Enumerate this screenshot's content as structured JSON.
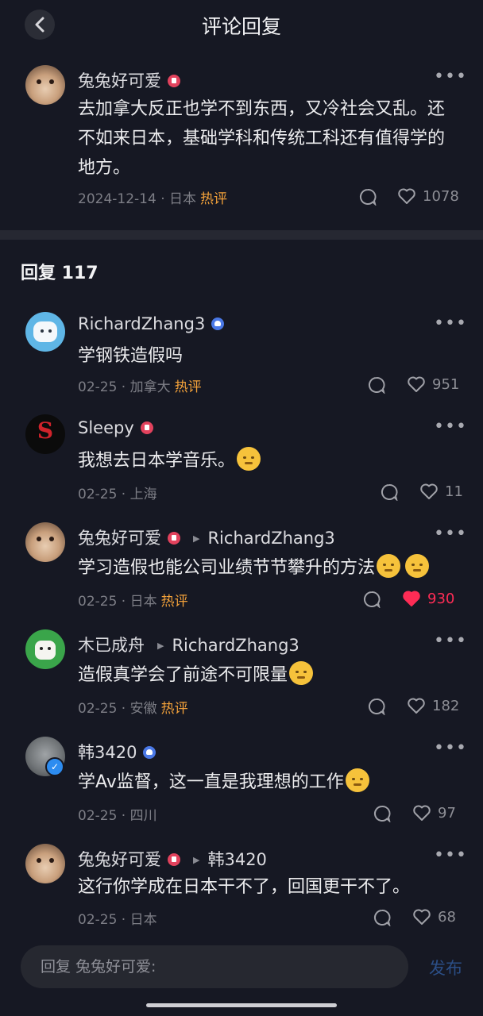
{
  "header": {
    "title": "评论回复"
  },
  "main_comment": {
    "name": "兔兔好可爱",
    "text": "去加拿大反正也学不到东西，又冷社会又乱。还不如来日本，基础学科和传统工科还有值得学的地方。",
    "date": "2024-12-14",
    "location": "日本",
    "hot_label": "热评",
    "likes": "1078"
  },
  "replies_header": {
    "label": "回复 117"
  },
  "replies": [
    {
      "name": "RichardZhang3",
      "text": "学钢铁造假吗",
      "date": "02-25",
      "location": "加拿大",
      "hot_label": "热评",
      "likes": "951"
    },
    {
      "name": "Sleepy",
      "text": "我想去日本学音乐。",
      "date": "02-25",
      "location": "上海",
      "likes": "11"
    },
    {
      "name": "兔兔好可爱",
      "reply_to": "RichardZhang3",
      "text": "学习造假也能公司业绩节节攀升的方法",
      "date": "02-25",
      "location": "日本",
      "hot_label": "热评",
      "likes": "930"
    },
    {
      "name": "木已成舟",
      "reply_to": "RichardZhang3",
      "text": "造假真学会了前途不可限量",
      "date": "02-25",
      "location": "安徽",
      "hot_label": "热评",
      "likes": "182"
    },
    {
      "name": "韩3420",
      "text": "学Av监督，这一直是我理想的工作",
      "date": "02-25",
      "location": "四川",
      "likes": "97"
    },
    {
      "name": "兔兔好可爱",
      "reply_to": "韩3420",
      "text": "这行你学成在日本干不了，回国更干不了。",
      "date": "02-25",
      "location": "日本",
      "likes": "68"
    }
  ],
  "bottom_bar": {
    "input_placeholder": "回复 兔兔好可爱:",
    "send_label": "发布"
  },
  "colors": {
    "background": "#161823",
    "hot": "#f2a13a",
    "liked": "#fe2c55",
    "send": "#2b4e86"
  }
}
